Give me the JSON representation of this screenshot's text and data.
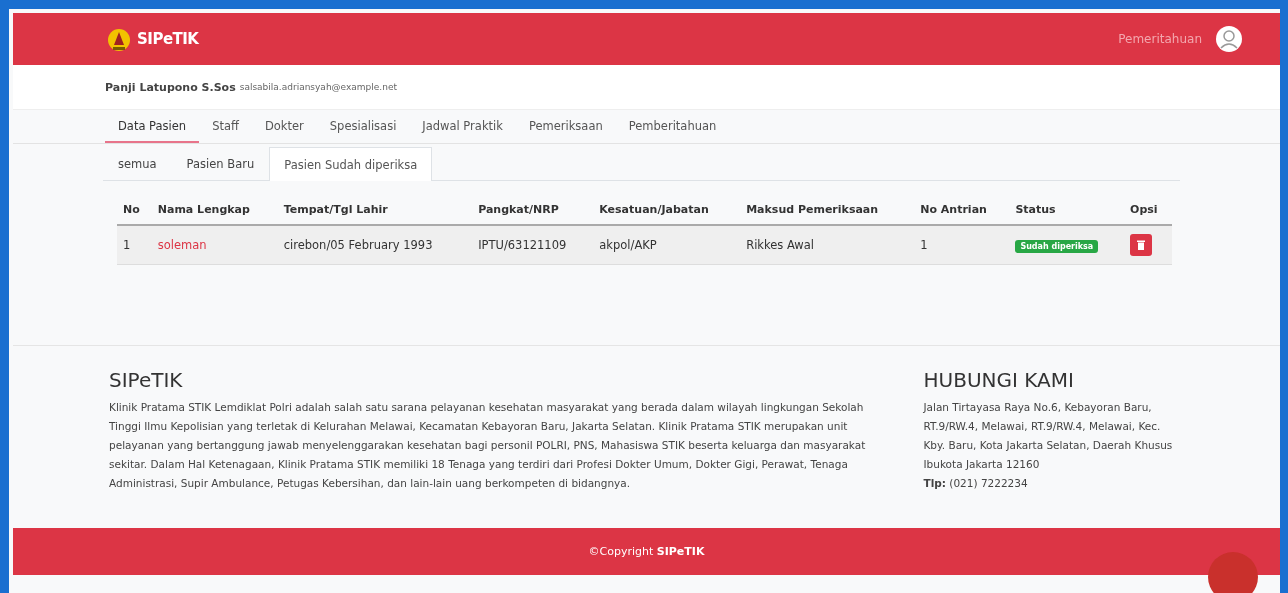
{
  "navbar": {
    "brand": "SIPeTIK",
    "link": "Pemeritahuan"
  },
  "user": {
    "name": "Panji Latupono S.Sos",
    "email": "salsabila.adriansyah@example.net"
  },
  "tabs": [
    {
      "label": "Data Pasien",
      "selected": true
    },
    {
      "label": "Staff",
      "selected": false
    },
    {
      "label": "Dokter",
      "selected": false
    },
    {
      "label": "Spesialisasi",
      "selected": false
    },
    {
      "label": "Jadwal Praktik",
      "selected": false
    },
    {
      "label": "Pemeriksaan",
      "selected": false
    },
    {
      "label": "Pemberitahuan",
      "selected": false
    }
  ],
  "subtabs": [
    {
      "label": "semua",
      "selected": false
    },
    {
      "label": "Pasien Baru",
      "selected": false
    },
    {
      "label": "Pasien Sudah diperiksa",
      "selected": true
    }
  ],
  "table": {
    "columns": [
      "No",
      "Nama Lengkap",
      "Tempat/Tgl Lahir",
      "Pangkat/NRP",
      "Kesatuan/Jabatan",
      "Maksud Pemeriksaan",
      "No Antrian",
      "Status",
      "Opsi"
    ],
    "rows": [
      {
        "no": "1",
        "name": "soleman",
        "birth": "cirebon/05 February 1993",
        "rank": "IPTU/63121109",
        "unit": "akpol/AKP",
        "purpose": "Rikkes Awal",
        "queue": "1",
        "status": "Sudah diperiksa"
      }
    ]
  },
  "footer": {
    "about_title": "SIPeTIK",
    "about_text": "Klinik Pratama STIK Lemdiklat Polri adalah salah satu sarana pelayanan kesehatan masyarakat yang berada dalam wilayah lingkungan Sekolah Tinggi Ilmu Kepolisian yang terletak di Kelurahan Melawai, Kecamatan Kebayoran Baru, Jakarta Selatan. Klinik Pratama STIK merupakan unit pelayanan yang bertanggung jawab menyelenggarakan kesehatan bagi personil POLRI, PNS, Mahasiswa STIK beserta keluarga dan masyarakat sekitar. Dalam Hal Ketenagaan, Klinik Pratama STIK memiliki 18 Tenaga yang terdiri dari Profesi Dokter Umum, Dokter Gigi, Perawat, Tenaga Administrasi, Supir Ambulance, Petugas Kebersihan, dan lain-lain uang berkompeten di bidangnya.",
    "contact_title": "HUBUNGI KAMI",
    "address": "Jalan Tirtayasa Raya No.6, Kebayoran Baru, RT.9/RW.4, Melawai, RT.9/RW.4, Melawai, Kec. Kby. Baru, Kota Jakarta Selatan, Daerah Khusus Ibukota Jakarta 12160",
    "phone": "**Tlp:** (021) 7222234"
  },
  "copyright": "©Copyright **SIPeTIK**"
}
